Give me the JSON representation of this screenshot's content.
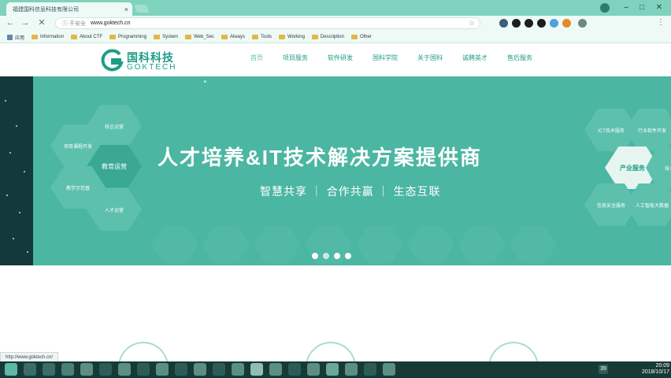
{
  "browser": {
    "tab_title": "福建国科信息科技有限公司",
    "tab_close": "×",
    "nav": {
      "back": "←",
      "forward": "→",
      "reload": "✕"
    },
    "address": {
      "security": "ⓘ 不安全",
      "url": "www.goktech.cn",
      "star": "☆"
    },
    "bookmarks": [
      "应用",
      "Information",
      "About CTF",
      "Programming",
      "System",
      "Web_Sec",
      "Always",
      "Tools",
      "Working",
      "Description",
      "Other"
    ],
    "status_url": "http://www.goktech.cn/",
    "window_controls": {
      "minimize": "–",
      "maximize": "□",
      "close": "✕"
    }
  },
  "site": {
    "logo": {
      "cn": "国科科技",
      "en": "GOKTECH"
    },
    "nav": [
      {
        "label": "首页",
        "active": true
      },
      {
        "label": "项目服务",
        "active": false
      },
      {
        "label": "软件研发",
        "active": false
      },
      {
        "label": "国科学院",
        "active": false
      },
      {
        "label": "关于国科",
        "active": false
      },
      {
        "label": "诚聘英才",
        "active": false
      },
      {
        "label": "售后服务",
        "active": false
      }
    ]
  },
  "banner": {
    "headline": "人才培养&IT技术解决方案提供商",
    "subline": "智慧共享 ｜ 合作共赢 ｜ 生态互联",
    "left_hexes": {
      "center": "教育运营",
      "top": "校企运营",
      "upper_left": "项目课程开发",
      "lower_left": "教学示范基",
      "bottom": "人才运营"
    },
    "right_hexes": {
      "center": "产业服务",
      "top_left": "ICT技术服务",
      "top_right": "行业软件开发",
      "right": "技术",
      "lower_left": "信息安全服务",
      "lower_right": "人工智能大数据"
    },
    "slide_count": 4,
    "active_slide": 2
  },
  "taskbar": {
    "time": "20:09",
    "date": "2018/10/17",
    "badge": "39"
  },
  "colors": {
    "brand": "#1e9d86",
    "banner": "#4bb6a2",
    "banner_dark": "#14393a",
    "tabbar": "#7fd2bd",
    "taskbar": "#173a37"
  }
}
